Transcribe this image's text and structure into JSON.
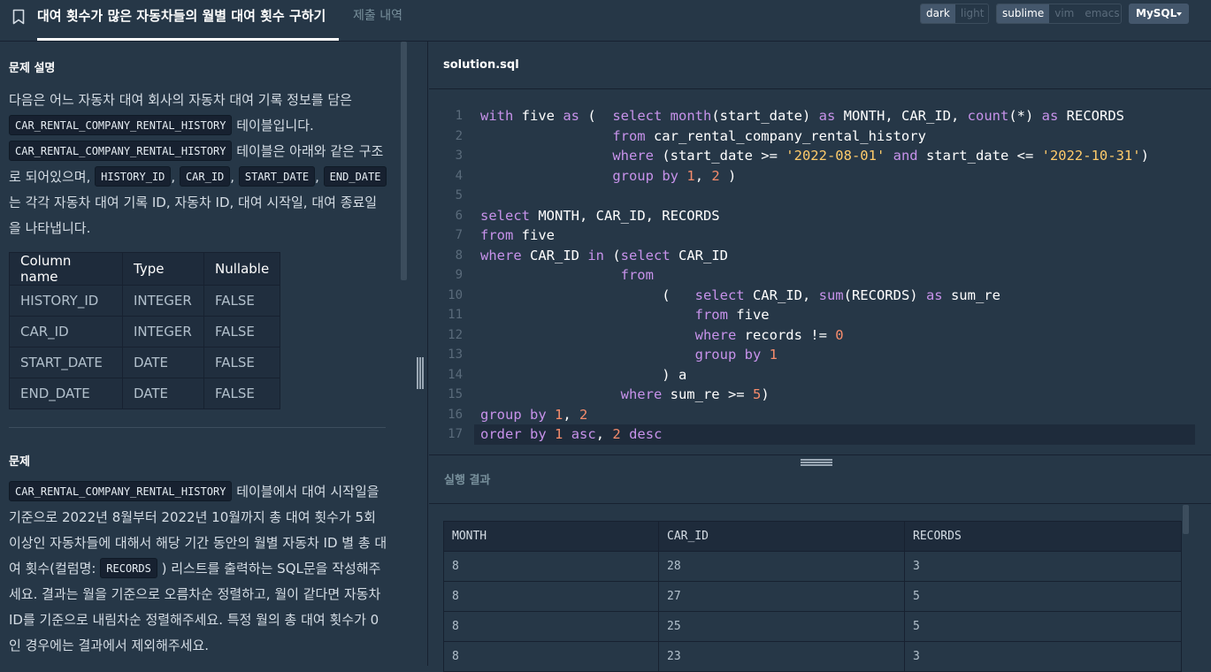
{
  "header": {
    "active_tab": "대여 횟수가 많은 자동차들의 월별 대여 횟수 구하기",
    "inactive_tab": "제출 내역",
    "theme_options": [
      "dark",
      "light"
    ],
    "theme_selected": "dark",
    "keymap_options": [
      "sublime",
      "vim",
      "emacs"
    ],
    "keymap_selected": "sublime",
    "language": "MySQL",
    "icons": [
      "bookmark-icon",
      "caret-down-icon"
    ]
  },
  "problem": {
    "section_title": "문제 설명",
    "desc_t1": "다음은 어느 자동차 대여 회사의 자동차 대여 기록 정보를 담은",
    "table_name": "CAR_RENTAL_COMPANY_RENTAL_HISTORY",
    "desc_t2": "테이블입니다.",
    "desc_t3": "테이블은 아래와 같은 구조로 되어있으며,",
    "col_history_id": "HISTORY_ID",
    "col_car_id": "CAR_ID",
    "col_start_date": "START_DATE",
    "col_end_date": "END_DATE",
    "comma": ",",
    "desc_t4": "는 각각 자동차 대여 기록 ID, 자동차 ID, 대여 시작일, 대여 종료일을 나타냅니다.",
    "schema_headers": [
      "Column name",
      "Type",
      "Nullable"
    ],
    "schema_rows": [
      [
        "HISTORY_ID",
        "INTEGER",
        "FALSE"
      ],
      [
        "CAR_ID",
        "INTEGER",
        "FALSE"
      ],
      [
        "START_DATE",
        "DATE",
        "FALSE"
      ],
      [
        "END_DATE",
        "DATE",
        "FALSE"
      ]
    ],
    "question_title": "문제",
    "q_t1": "테이블에서 대여 시작일을 기준으로 2022년 8월부터 2022년 10월까지 총 대여 횟수가 5회 이상인 자동차들에 대해서 해당 기간 동안의 월별 자동차 ID 별 총 대여 횟수(컬럼명:",
    "q_code": "RECORDS",
    "q_t2": ") 리스트를 출력하는 SQL문을 작성해주세요. 결과는 월을 기준으로 오름차순 정렬하고, 월이 같다면 자동차 ID를 기준으로 내림차순 정렬해주세요. 특정 월의 총 대여 횟수가 0인 경우에는 결과에서 제외해주세요."
  },
  "editor": {
    "filename": "solution.sql",
    "lines": [
      "with five as (  select month(start_date) as MONTH, CAR_ID, count(*) as RECORDS",
      "                from car_rental_company_rental_history",
      "                where (start_date >= '2022-08-01' and start_date <= '2022-10-31')",
      "                group by 1, 2 )",
      "",
      "select MONTH, CAR_ID, RECORDS",
      "from five",
      "where CAR_ID in (select CAR_ID",
      "                 from",
      "                      (   select CAR_ID, sum(RECORDS) as sum_re",
      "                          from five",
      "                          where records != 0",
      "                          group by 1",
      "                      ) a",
      "                 where sum_re >= 5)",
      "group by 1, 2",
      "order by 1 asc, 2 desc"
    ],
    "current_line": 17
  },
  "result": {
    "title": "실행 결과",
    "headers": [
      "MONTH",
      "CAR_ID",
      "RECORDS"
    ],
    "rows": [
      [
        "8",
        "28",
        "3"
      ],
      [
        "8",
        "27",
        "5"
      ],
      [
        "8",
        "25",
        "5"
      ],
      [
        "8",
        "23",
        "3"
      ]
    ]
  }
}
